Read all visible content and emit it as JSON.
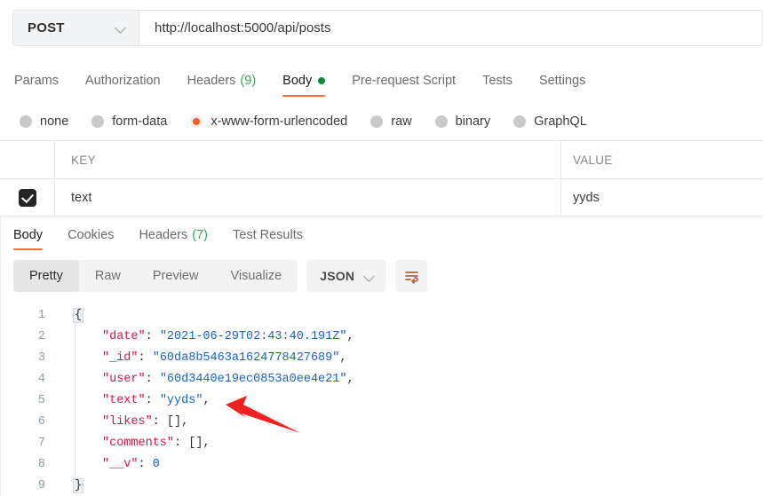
{
  "request": {
    "method": "POST",
    "url": "http://localhost:5000/api/posts",
    "tabs": [
      {
        "label": "Params",
        "count": "",
        "dot": false,
        "active": false
      },
      {
        "label": "Authorization",
        "count": "",
        "dot": false,
        "active": false
      },
      {
        "label": "Headers",
        "count": "(9)",
        "dot": false,
        "active": false
      },
      {
        "label": "Body",
        "count": "",
        "dot": true,
        "active": true
      },
      {
        "label": "Pre-request Script",
        "count": "",
        "dot": false,
        "active": false
      },
      {
        "label": "Tests",
        "count": "",
        "dot": false,
        "active": false
      },
      {
        "label": "Settings",
        "count": "",
        "dot": false,
        "active": false
      }
    ],
    "body_types": [
      {
        "label": "none",
        "selected": false
      },
      {
        "label": "form-data",
        "selected": false
      },
      {
        "label": "x-www-form-urlencoded",
        "selected": true
      },
      {
        "label": "raw",
        "selected": false
      },
      {
        "label": "binary",
        "selected": false
      },
      {
        "label": "GraphQL",
        "selected": false
      }
    ],
    "table": {
      "columns": [
        "KEY",
        "VALUE"
      ],
      "rows": [
        {
          "checked": true,
          "key": "text",
          "value": "yyds"
        }
      ]
    }
  },
  "response": {
    "tabs": [
      {
        "label": "Body",
        "count": "",
        "active": true
      },
      {
        "label": "Cookies",
        "count": "",
        "active": false
      },
      {
        "label": "Headers",
        "count": "(7)",
        "active": false
      },
      {
        "label": "Test Results",
        "count": "",
        "active": false
      }
    ],
    "view_modes": [
      {
        "label": "Pretty",
        "active": true
      },
      {
        "label": "Raw",
        "active": false
      },
      {
        "label": "Preview",
        "active": false
      },
      {
        "label": "Visualize",
        "active": false
      }
    ],
    "format": "JSON",
    "wrap_icon": "word-wrap-icon",
    "body_lines": [
      {
        "n": "1",
        "indent": 0,
        "tokens": [
          {
            "t": "{",
            "c": "brace"
          }
        ]
      },
      {
        "n": "2",
        "indent": 1,
        "tokens": [
          {
            "t": "\"date\"",
            "c": "k"
          },
          {
            "t": ": ",
            "c": "p"
          },
          {
            "t": "\"2021-06-29T02:43:40.191Z\"",
            "c": "s"
          },
          {
            "t": ",",
            "c": "p"
          }
        ]
      },
      {
        "n": "3",
        "indent": 1,
        "tokens": [
          {
            "t": "\"_id\"",
            "c": "k"
          },
          {
            "t": ": ",
            "c": "p"
          },
          {
            "t": "\"60da8b5463a1624778427689\"",
            "c": "s"
          },
          {
            "t": ",",
            "c": "p"
          }
        ]
      },
      {
        "n": "4",
        "indent": 1,
        "tokens": [
          {
            "t": "\"user\"",
            "c": "k"
          },
          {
            "t": ": ",
            "c": "p"
          },
          {
            "t": "\"60d3440e19ec0853a0ee4e21\"",
            "c": "s"
          },
          {
            "t": ",",
            "c": "p"
          }
        ]
      },
      {
        "n": "5",
        "indent": 1,
        "tokens": [
          {
            "t": "\"text\"",
            "c": "k"
          },
          {
            "t": ": ",
            "c": "p"
          },
          {
            "t": "\"yyds\"",
            "c": "s"
          },
          {
            "t": ",",
            "c": "p"
          }
        ]
      },
      {
        "n": "6",
        "indent": 1,
        "tokens": [
          {
            "t": "\"likes\"",
            "c": "k"
          },
          {
            "t": ": ",
            "c": "p"
          },
          {
            "t": "[],",
            "c": "p"
          }
        ]
      },
      {
        "n": "7",
        "indent": 1,
        "tokens": [
          {
            "t": "\"comments\"",
            "c": "k"
          },
          {
            "t": ": ",
            "c": "p"
          },
          {
            "t": "[],",
            "c": "p"
          }
        ]
      },
      {
        "n": "8",
        "indent": 1,
        "tokens": [
          {
            "t": "\"__v\"",
            "c": "k"
          },
          {
            "t": ": ",
            "c": "p"
          },
          {
            "t": "0",
            "c": "n"
          }
        ]
      },
      {
        "n": "9",
        "indent": 0,
        "tokens": [
          {
            "t": "}",
            "c": "brace"
          }
        ]
      }
    ]
  },
  "annotation": {
    "arrow_color": "#ee2222",
    "points_at": "text-field-line"
  }
}
